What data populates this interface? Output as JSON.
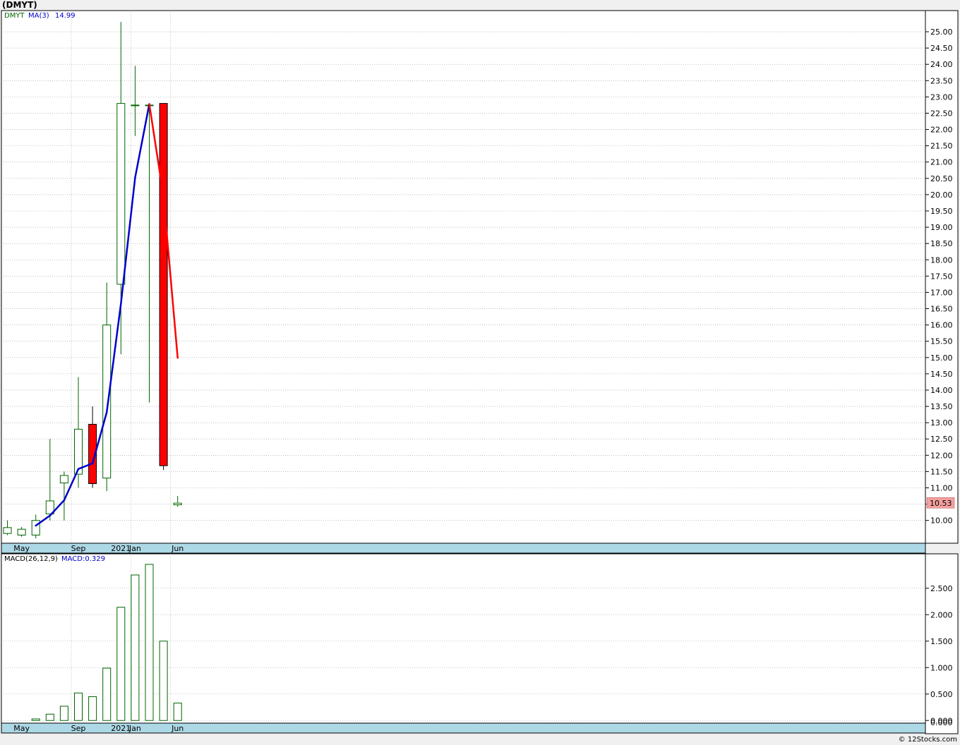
{
  "header": {
    "ticker_title": "(DMYT)"
  },
  "footer": {
    "credit": "© 12Stocks.com"
  },
  "colors": {
    "up": "#006400",
    "down": "#ff0000",
    "ma": "#0000cc",
    "ma_down": "#ff0000",
    "axis_band": "#add8e6",
    "price_tag": "#f4a0a0",
    "grid": "#999999"
  },
  "chart_data": [
    {
      "type": "candlestick",
      "legend": {
        "symbol": "DMYT",
        "ma_label": "MA(3)",
        "ma_value": "14.99"
      },
      "ylim": [
        9.3,
        25.65
      ],
      "y_ticks": [
        "10.00",
        "10.50",
        "11.00",
        "11.50",
        "12.00",
        "12.50",
        "13.00",
        "13.50",
        "14.00",
        "14.50",
        "15.00",
        "15.50",
        "16.00",
        "16.50",
        "17.00",
        "17.50",
        "18.00",
        "18.50",
        "19.00",
        "19.50",
        "20.00",
        "20.50",
        "21.00",
        "21.50",
        "22.00",
        "22.50",
        "23.00",
        "23.50",
        "24.00",
        "24.50",
        "25.00"
      ],
      "x_labels": [
        {
          "label": "May",
          "index": 1
        },
        {
          "label": "Sep",
          "index": 5
        },
        {
          "label": "2021",
          "index": 8
        },
        {
          "label": "Jan",
          "index": 9
        },
        {
          "label": "Jun",
          "index": 12
        }
      ],
      "last_price": "10.53",
      "candles": [
        {
          "o": 9.6,
          "h": 10.0,
          "l": 9.55,
          "c": 9.78
        },
        {
          "o": 9.55,
          "h": 9.8,
          "l": 9.5,
          "c": 9.73
        },
        {
          "o": 9.55,
          "h": 10.18,
          "l": 9.45,
          "c": 10.0
        },
        {
          "o": 10.2,
          "h": 12.5,
          "l": 10.0,
          "c": 10.6
        },
        {
          "o": 11.15,
          "h": 11.5,
          "l": 10.0,
          "c": 11.38
        },
        {
          "o": 11.42,
          "h": 14.4,
          "l": 11.0,
          "c": 12.8
        },
        {
          "o": 12.95,
          "h": 13.5,
          "l": 11.0,
          "c": 11.13
        },
        {
          "o": 11.3,
          "h": 17.3,
          "l": 10.9,
          "c": 16.0
        },
        {
          "o": 17.25,
          "h": 25.3,
          "l": 15.1,
          "c": 22.8
        },
        {
          "o": 22.75,
          "h": 23.95,
          "l": 21.8,
          "c": 22.75
        },
        {
          "o": 22.75,
          "h": 22.8,
          "l": 13.62,
          "c": 22.75
        },
        {
          "o": 22.8,
          "h": 22.8,
          "l": 11.55,
          "c": 11.68
        },
        {
          "o": 10.48,
          "h": 10.75,
          "l": 10.42,
          "c": 10.53
        }
      ],
      "ma": [
        {
          "i": 2,
          "v": 9.84
        },
        {
          "i": 3,
          "v": 10.15
        },
        {
          "i": 4,
          "v": 10.62
        },
        {
          "i": 5,
          "v": 11.58
        },
        {
          "i": 6,
          "v": 11.75
        },
        {
          "i": 7,
          "v": 13.32
        },
        {
          "i": 8,
          "v": 16.65
        },
        {
          "i": 9,
          "v": 20.52
        },
        {
          "i": 10,
          "v": 22.78
        },
        {
          "i": 11,
          "v": 19.95
        },
        {
          "i": 12,
          "v": 14.99
        }
      ]
    },
    {
      "type": "bar",
      "legend": {
        "label": "MACD(26,12,9)",
        "macd_label": "MACD:0.329"
      },
      "ylim": [
        -0.05,
        3.15
      ],
      "y_ticks": [
        "0.000",
        "0.500",
        "1.000",
        "1.500",
        "2.000",
        "2.500"
      ],
      "x_labels": [
        {
          "label": "May",
          "index": 1
        },
        {
          "label": "Sep",
          "index": 5
        },
        {
          "label": "2021",
          "index": 8
        },
        {
          "label": "Jan",
          "index": 9
        },
        {
          "label": "Jun",
          "index": 12
        }
      ],
      "values": [
        0.0,
        0.0,
        0.03,
        0.12,
        0.27,
        0.52,
        0.45,
        0.99,
        2.14,
        2.75,
        2.95,
        1.5,
        0.329
      ]
    }
  ]
}
